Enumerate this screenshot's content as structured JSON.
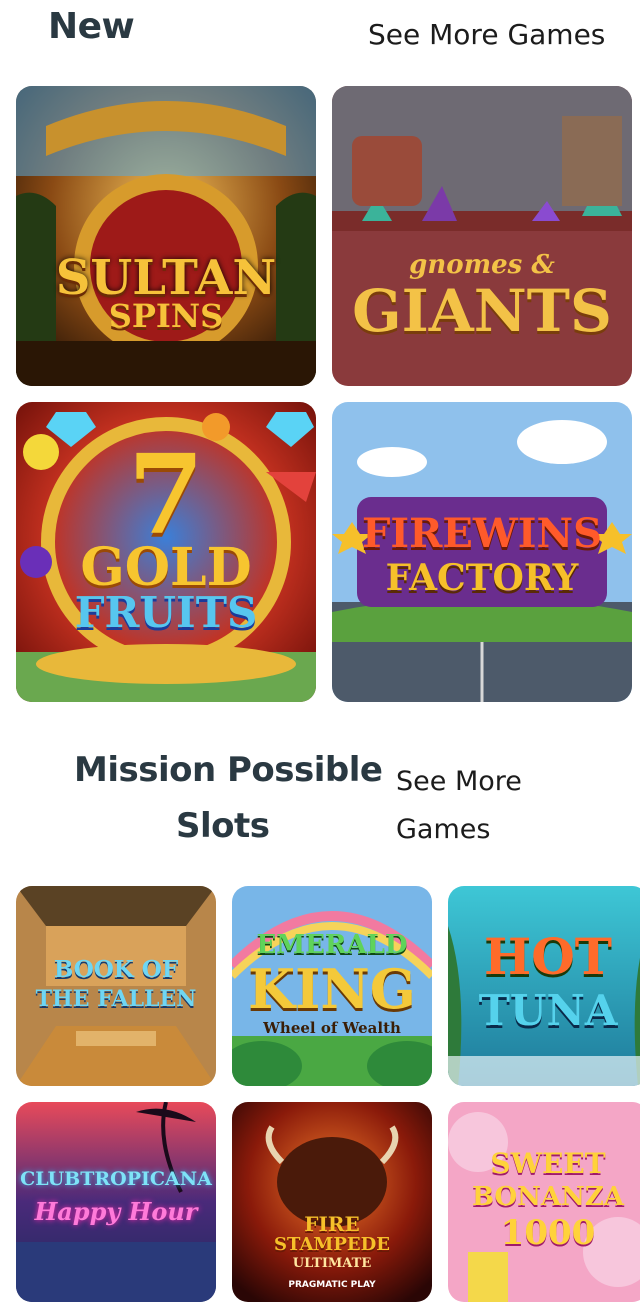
{
  "sections": {
    "new": {
      "title": "New",
      "see_more": "See More Games",
      "games": [
        {
          "line1": "SULTAN",
          "line2": "SPINS"
        },
        {
          "line1": "gnomes &",
          "line2": "GIANTS"
        },
        {
          "line1": "7",
          "line2": "GOLD",
          "line3": "FRUITS"
        },
        {
          "line1": "FIREWINS",
          "line2": "FACTORY"
        }
      ]
    },
    "mission": {
      "title_line1": "Mission Possible",
      "title_line2": "Slots",
      "see_more_line1": "See More",
      "see_more_line2": "Games",
      "games": [
        {
          "line1": "BOOK OF",
          "line2": "THE FALLEN"
        },
        {
          "line1": "EMERALD",
          "line2": "KING",
          "line3": "Wheel of Wealth"
        },
        {
          "line1": "HOT",
          "line2": "TUNA"
        },
        {
          "line1": "CLUBTROPICANA",
          "line2": "Happy Hour"
        },
        {
          "line1": "FIRE",
          "line2": "STAMPEDE",
          "line3": "ULTIMATE",
          "line4": "PRAGMATIC PLAY"
        },
        {
          "line1": "SWEET",
          "line2": "BONANZA",
          "line3": "1000"
        }
      ]
    }
  }
}
